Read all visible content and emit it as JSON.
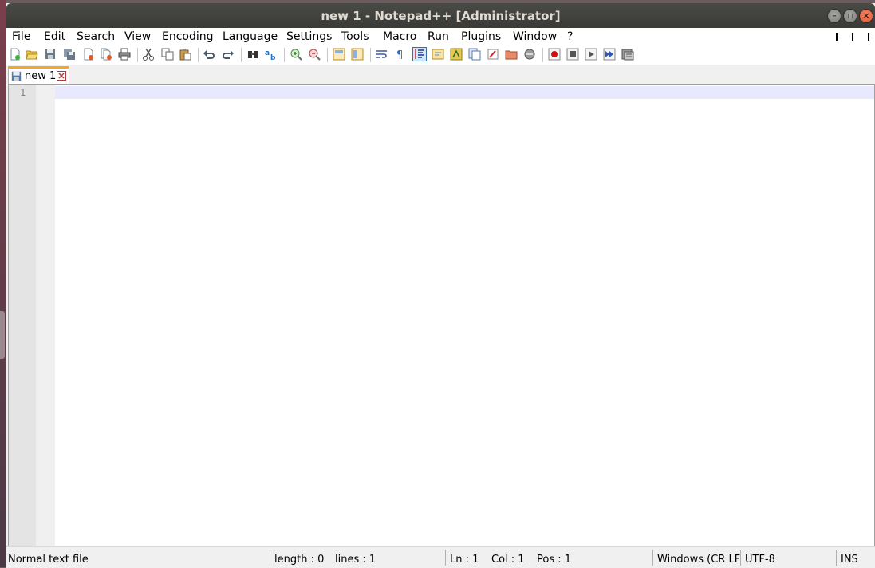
{
  "window": {
    "title": "new 1 - Notepad++ [Administrator]",
    "controls": [
      "minimize-icon",
      "maximize-icon",
      "close-icon"
    ]
  },
  "menu": {
    "file": "File",
    "edit": "Edit",
    "search": "Search",
    "view": "View",
    "encoding": "Encoding",
    "language": "Language",
    "settings": "Settings",
    "tools": "Tools",
    "macro": "Macro",
    "run": "Run",
    "plugins": "Plugins",
    "window": "Window",
    "help": "?"
  },
  "toolbar": {
    "icons": [
      "new-file-icon",
      "open-file-icon",
      "save-icon",
      "save-all-icon",
      "close-icon",
      "close-all-icon",
      "print-icon",
      "cut-icon",
      "copy-icon",
      "paste-icon",
      "undo-icon",
      "redo-icon",
      "find-icon",
      "replace-icon",
      "zoom-in-icon",
      "zoom-out-icon",
      "sync-vertical-icon",
      "sync-horizontal-icon",
      "word-wrap-icon",
      "show-all-chars-icon",
      "indent-guide-icon",
      "user-language-icon",
      "document-map-icon",
      "function-list-icon",
      "folder-workspace-icon",
      "monitoring-icon",
      "record-macro-icon",
      "stop-record-icon",
      "playback-icon",
      "run-macro-multiple-icon",
      "save-macro-icon"
    ]
  },
  "tabs": [
    {
      "label": "new 1",
      "active": true
    }
  ],
  "editor": {
    "line_numbers": [
      "1"
    ],
    "content": ""
  },
  "status": {
    "filetype": "Normal text file",
    "length": "length : 0",
    "lines": "lines : 1",
    "ln": "Ln : 1",
    "col": "Col : 1",
    "pos": "Pos : 1",
    "eol": "Windows (CR LF)",
    "encoding": "UTF-8",
    "mode": "INS"
  },
  "colors": {
    "titlebar": "#3c3b37",
    "current_line": "#e8e8ff",
    "tab_accent": "#f5a623"
  }
}
